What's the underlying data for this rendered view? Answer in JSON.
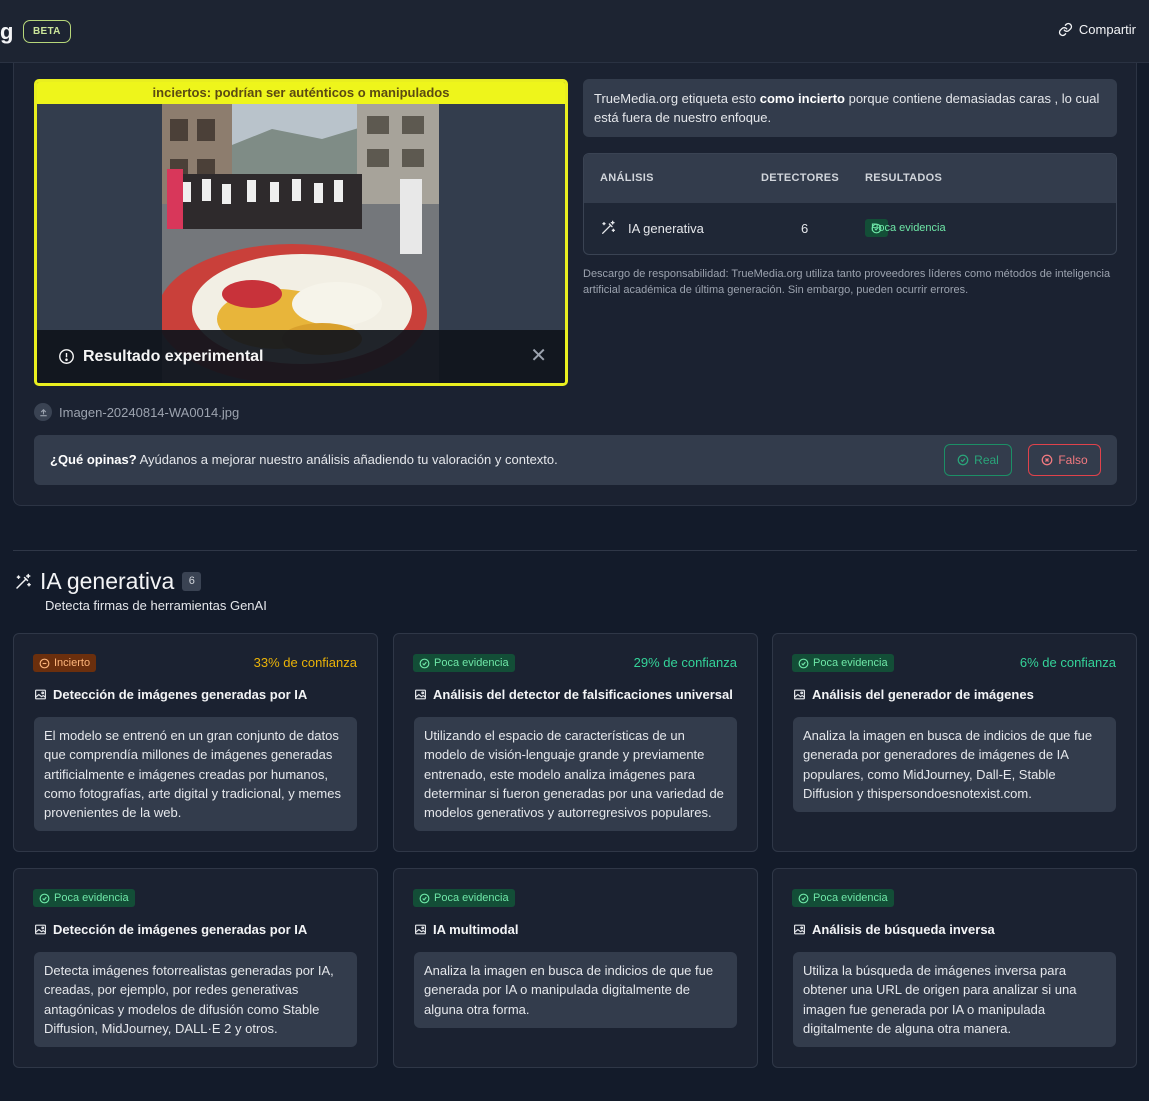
{
  "header": {
    "brand_fragment": "g",
    "beta": "BETA",
    "share": "Compartir"
  },
  "image_card": {
    "banner": "inciertos: podrían ser auténticos o manipulados",
    "experimental": "Resultado experimental",
    "filename": "Imagen-20240814-WA0014.jpg"
  },
  "summary": {
    "p1": "TrueMedia.org etiqueta esto ",
    "p_bold": "como incierto",
    "p2": " porque contiene demasiadas caras , lo cual está fuera de nuestro enfoque."
  },
  "table": {
    "headers": [
      "ANÁLISIS",
      "DETECTORES",
      "RESULTADOS"
    ],
    "row": {
      "analysis": "IA generativa",
      "detectors": "6",
      "result": "Poca evidencia"
    }
  },
  "disclaimer": "Descargo de responsabilidad: TrueMedia.org utiliza tanto proveedores líderes como métodos de inteligencia artificial académica de última generación. Sin embargo, pueden ocurrir errores.",
  "feedback": {
    "question": "¿Qué opinas?",
    "text": " Ayúdanos a mejorar nuestro análisis añadiendo tu valoración y contexto.",
    "real": "Real",
    "fake": "Falso"
  },
  "section": {
    "title": "IA generativa",
    "count": "6",
    "subtitle": "Detecta firmas de herramientas GenAI"
  },
  "cards": [
    {
      "badge": "Incierto",
      "badge_type": "orange",
      "confidence": "33% de confianza",
      "title": "Detección de imágenes generadas por IA",
      "description": "El modelo se entrenó en un gran conjunto de datos que comprendía millones de imágenes generadas artificialmente e imágenes creadas por humanos, como fotografías, arte digital y tradicional, y memes provenientes de la web."
    },
    {
      "badge": "Poca evidencia",
      "badge_type": "green",
      "confidence": "29% de confianza",
      "title": "Análisis del detector de falsificaciones universal",
      "description": "Utilizando el espacio de características de un modelo de visión-lenguaje grande y previamente entrenado, este modelo analiza imágenes para determinar si fueron generadas por una variedad de modelos generativos y autorregresivos populares."
    },
    {
      "badge": "Poca evidencia",
      "badge_type": "green",
      "confidence": "6% de confianza",
      "title": "Análisis del generador de imágenes",
      "description": "Analiza la imagen en busca de indicios de que fue generada por generadores de imágenes de IA populares, como MidJourney, Dall-E, Stable Diffusion y thispersondoesnotexist.com."
    },
    {
      "badge": "Poca evidencia",
      "badge_type": "green",
      "confidence": "",
      "title": "Detección de imágenes generadas por IA",
      "description": "Detecta imágenes fotorrealistas generadas por IA, creadas, por ejemplo, por redes generativas antagónicas y modelos de difusión como Stable Diffusion, MidJourney, DALL·E 2 y otros."
    },
    {
      "badge": "Poca evidencia",
      "badge_type": "green",
      "confidence": "",
      "title": "IA multimodal",
      "description": "Analiza la imagen en busca de indicios de que fue generada por IA o manipulada digitalmente de alguna otra forma."
    },
    {
      "badge": "Poca evidencia",
      "badge_type": "green",
      "confidence": "",
      "title": "Análisis de búsqueda inversa",
      "description": "Utiliza la búsqueda de imágenes inversa para obtener una URL de origen para analizar si una imagen fue generada por IA o manipulada digitalmente de alguna otra manera."
    }
  ],
  "colors": {
    "background": "#131b2a",
    "panel": "#1b2231",
    "banner_yellow": "#eef51b",
    "green": "#34d399",
    "orange": "#eab308",
    "red": "#e0424b"
  }
}
